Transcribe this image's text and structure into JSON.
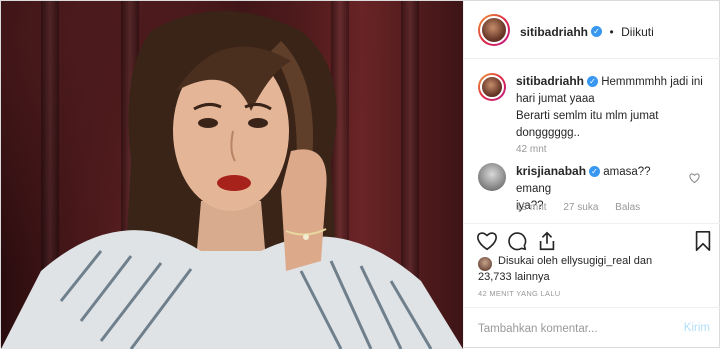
{
  "header": {
    "username": "sitibadriahh",
    "separator": "•",
    "follow_state": "Diikuti",
    "verified_glyph": "✓"
  },
  "caption": {
    "username": "sitibadriahh",
    "line1": "Hemmmmhh jadi ini",
    "line2": "hari jumat yaaa",
    "line3": "Berarti semlm itu mlm jumat",
    "line4": "dongggggg..",
    "time": "42 mnt"
  },
  "comments": [
    {
      "username": "krisjianabah",
      "line1": "amasa?? emang",
      "line2": "iya??",
      "time": "18 mnt",
      "likes": "27 suka",
      "reply": "Balas"
    }
  ],
  "likes": {
    "line1": "Disukai oleh ellysugigi_real  dan",
    "line2": "23,733 lainnya"
  },
  "timestamp": "42 MENIT YANG LALU",
  "add_comment": {
    "placeholder": "Tambahkan komentar...",
    "post_label": "Kirim"
  },
  "icons": {
    "like": "heart-icon",
    "comment": "comment-bubble-icon",
    "share": "share-icon",
    "save": "bookmark-icon",
    "comment_like": "small-heart-icon"
  },
  "colors": {
    "verified": "#3897f0",
    "post_disabled": "#b2dffc",
    "meta": "#999999"
  }
}
